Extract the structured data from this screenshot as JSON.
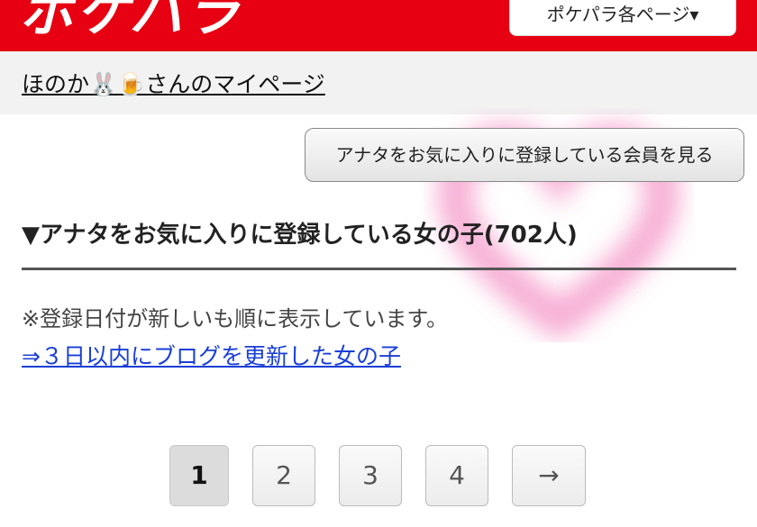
{
  "header": {
    "logo_text": "ポケパラ",
    "menu_label": "ポケパラ各ページ▾",
    "brand_color": "#e60012"
  },
  "mypage": {
    "link_text": "ほのか🐰🍺さんのマイページ"
  },
  "favorites_button": {
    "label": "アナタをお気に入りに登録している会員を見る"
  },
  "section": {
    "title": "▼アナタをお気に入りに登録している女の子(702人)",
    "note": "※登録日付が新しいも順に表示しています。",
    "blog_link": "⇒３日以内にブログを更新した女の子"
  },
  "pagination": {
    "pages": [
      "1",
      "2",
      "3",
      "4"
    ],
    "current": "1",
    "next_label": "→"
  },
  "decoration": {
    "heart_icon": "heart-icon",
    "heart_color": "#f06bb0"
  }
}
